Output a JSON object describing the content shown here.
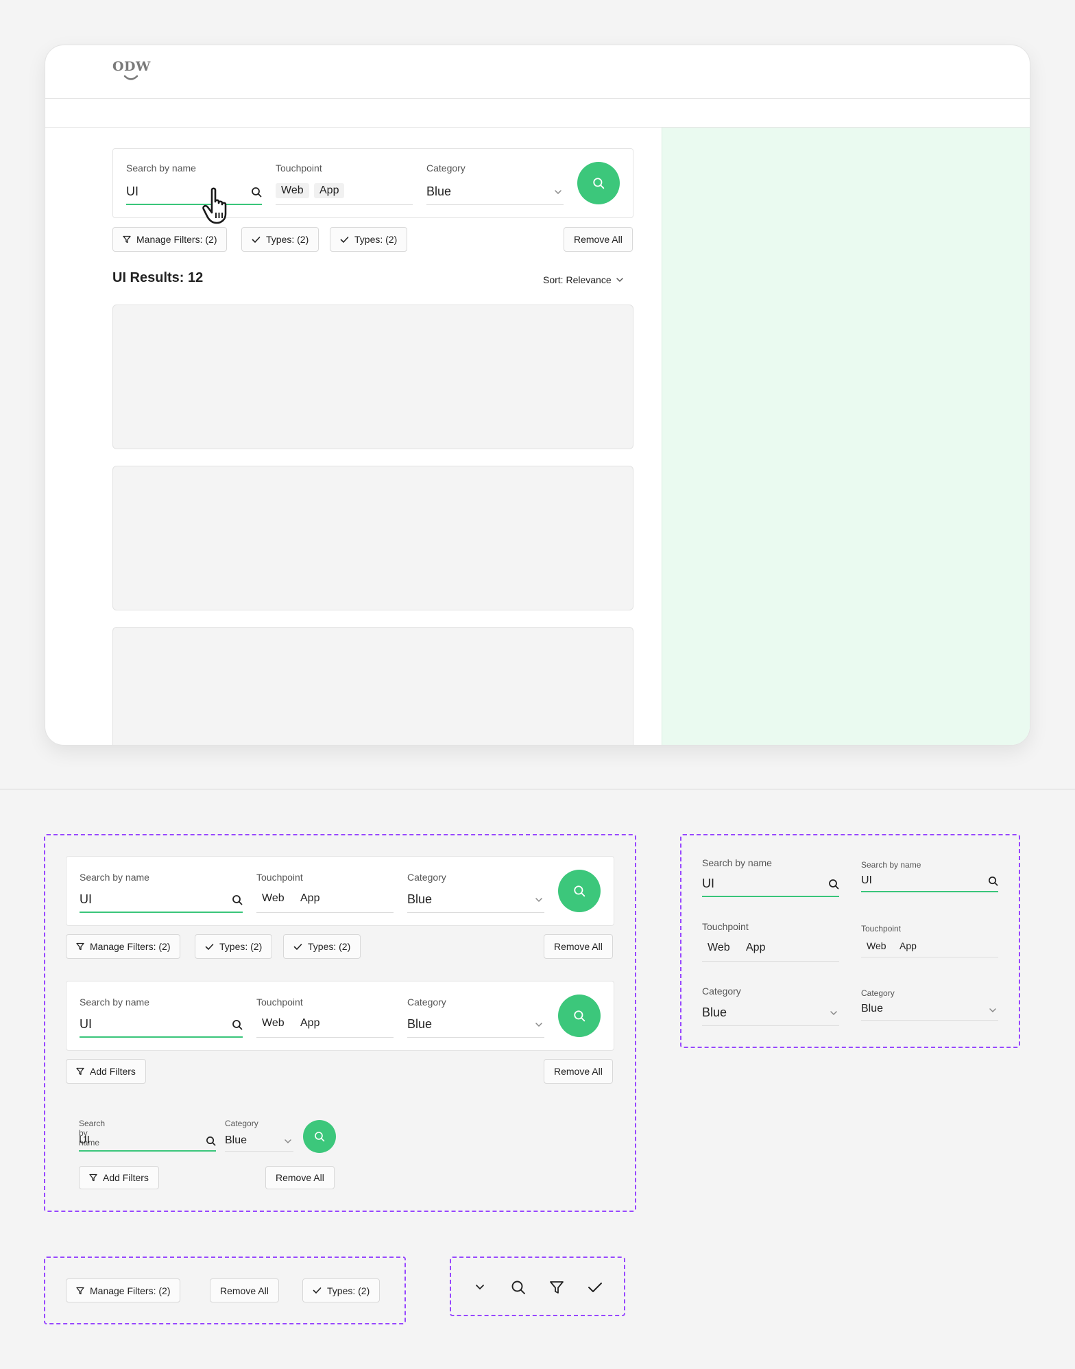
{
  "logo": {
    "text": "ODW"
  },
  "search": {
    "name_label": "Search by name",
    "name_value": "UI",
    "touchpoint_label": "Touchpoint",
    "touchpoint_chips": [
      "Web",
      "App"
    ],
    "category_label": "Category",
    "category_value": "Blue"
  },
  "filters": {
    "manage_label": "Manage Filters: (2)",
    "types_label": "Types: (2)",
    "add_label": "Add Filters",
    "remove_label": "Remove All"
  },
  "results": {
    "title": "UI Results: 12",
    "sort_label": "Sort: Relevance"
  },
  "colors": {
    "accent": "#3cc77b",
    "panel": "#eafaf0",
    "dashed_frame": "#9747ff"
  },
  "icons": [
    "search-icon",
    "filter-icon",
    "check-icon",
    "chevron-down-icon",
    "hand-pointer-icon"
  ]
}
